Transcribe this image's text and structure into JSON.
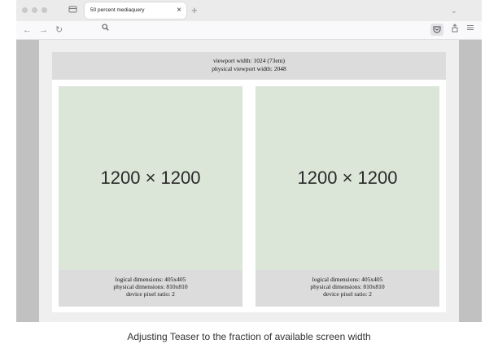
{
  "browser": {
    "tab_title": "50 percent mediaquery",
    "tab_close": "×",
    "new_tab": "+",
    "tab_list": "⌄",
    "nav_back": "←",
    "nav_forward": "→",
    "nav_reload": "↻",
    "search_glyph": "⚲",
    "pocket_glyph": "⛉",
    "extensions_glyph": "⇪",
    "menu_glyph": "≡"
  },
  "page": {
    "viewport_width": "viewport width: 1024 (73em)",
    "physical_viewport_width": "physical viewport width: 2048",
    "cards": [
      {
        "image_label": "1200 × 1200",
        "logical_dimensions": "logical dimensions: 405x405",
        "physical_dimensions": "physical dimensions: 810x810",
        "device_pixel_ratio": "device pixel ratio: 2"
      },
      {
        "image_label": "1200 × 1200",
        "logical_dimensions": "logical dimensions: 405x405",
        "physical_dimensions": "physical dimensions: 810x810",
        "device_pixel_ratio": "device pixel ratio: 2"
      }
    ]
  },
  "caption": "Adjusting Teaser to the fraction of available screen width",
  "colors": {
    "image_placeholder": "#dbe6d8",
    "info_panel": "#dcdcdc",
    "viewport_gutter": "#c1c1c1"
  }
}
